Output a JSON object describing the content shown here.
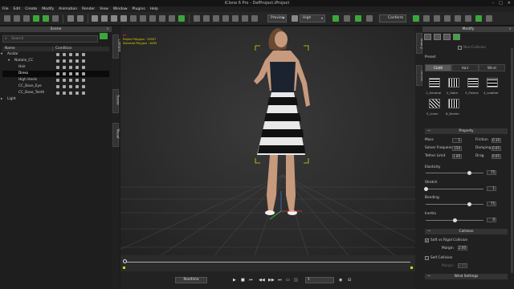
{
  "window": {
    "title": "iClone 6 Pro - DefProject.iProject"
  },
  "menu": [
    "File",
    "Edit",
    "Create",
    "Modify",
    "Animation",
    "Render",
    "View",
    "Window",
    "Plugins",
    "Help"
  ],
  "toolbar": {
    "preview_select": "Preview",
    "quality_select": "High",
    "conform_label": "Conform"
  },
  "scene_panel": {
    "title": "Scene",
    "search_placeholder": "Search",
    "columns": [
      "Name",
      "Condition"
    ],
    "tree": [
      {
        "label": "Avatar",
        "indent": 0,
        "expander": "▾",
        "selected": false
      },
      {
        "label": "Natalie_CC",
        "indent": 1,
        "expander": "▾",
        "selected": false
      },
      {
        "label": "Hair",
        "indent": 2,
        "expander": "",
        "selected": false
      },
      {
        "label": "Dress",
        "indent": 2,
        "expander": "",
        "selected": true
      },
      {
        "label": "High Heels",
        "indent": 2,
        "expander": "",
        "selected": false
      },
      {
        "label": "CC_Base_Eye",
        "indent": 2,
        "expander": "",
        "selected": false
      },
      {
        "label": "CC_Base_Teeth",
        "indent": 2,
        "expander": "",
        "selected": false
      },
      {
        "label": "Light",
        "indent": 0,
        "expander": "▸",
        "selected": false
      }
    ]
  },
  "left_vertical_tabs": [
    "Content",
    "Scene",
    "Visual"
  ],
  "right_vertical_tabs": [
    "Modify",
    "Render"
  ],
  "viewport": {
    "info_line1": "Project Polygon : 35557",
    "info_line2": "Selected Polygon : 6435",
    "fps_label": "60"
  },
  "playbar": {
    "realtime_label": "Realtime",
    "frame_value": "1"
  },
  "modify_panel": {
    "title": "Modify",
    "non_collision_label": "Non-Collision",
    "preset_label": "Preset",
    "preset_tabs": [
      "Cloth",
      "Hair",
      "Wind"
    ],
    "presets": [
      "1_General",
      "2_Satin",
      "3_Fleece",
      "4_Leather",
      "5_Linen",
      "6_Denim"
    ],
    "property_section": "Property",
    "mass_label": "Mass",
    "mass_value": "1",
    "friction_label": "Friction",
    "friction_value": "0.10",
    "solver_label": "Solver Frequency",
    "solver_value": "150",
    "damping_label": "Damping",
    "damping_value": "0.05",
    "tether_label": "Tether Limit",
    "tether_value": "1.00",
    "drag_label": "Drag",
    "drag_value": "0.05",
    "elasticity_label": "Elasticity",
    "elasticity_value": "75",
    "elasticity_fraction": 0.75,
    "stretch_label": "Stretch",
    "stretch_value": "1",
    "stretch_fraction": 0.01,
    "bending_label": "Bending",
    "bending_value": "75",
    "bending_fraction": 0.75,
    "inertia_label": "Inertia",
    "inertia_value": "0",
    "inertia_fraction": 0.5,
    "collision_section": "Collision",
    "soft_rigid_label": "Soft vs Rigid Collision",
    "margin_label": "Margin",
    "margin_value": "2.00",
    "self_collision_label": "Self Collision",
    "self_margin_label": "Margin",
    "self_margin_value": "2.00",
    "wind_section": "Wind Settings"
  },
  "colors": {
    "accent_green": "#3ca63c",
    "selection_yellow": "#d6d600"
  }
}
